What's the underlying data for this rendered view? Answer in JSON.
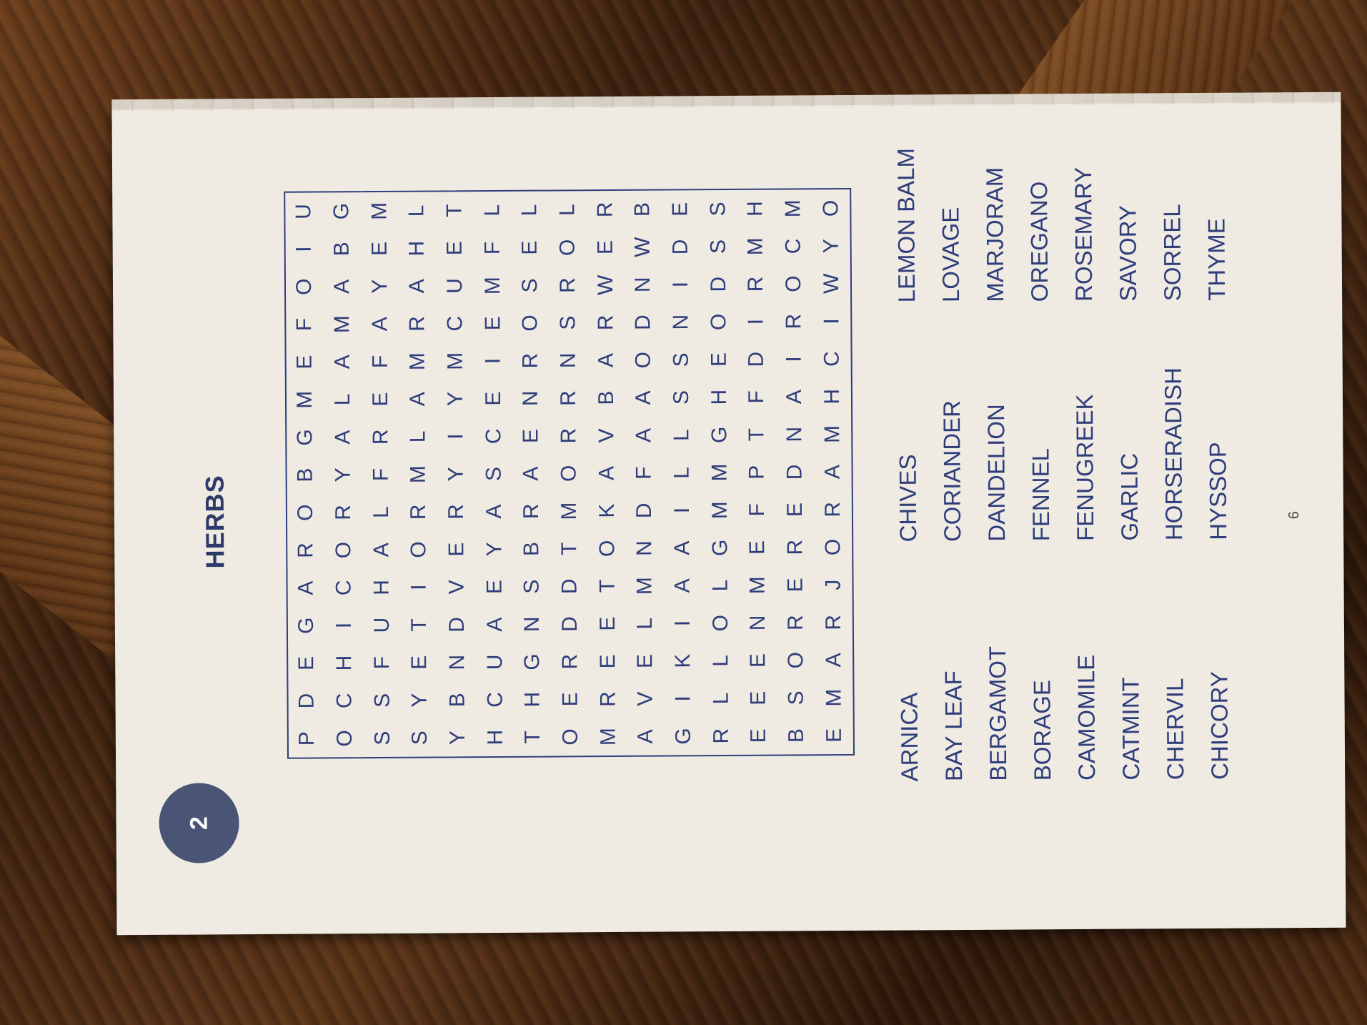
{
  "puzzle": {
    "number": "2",
    "title": "HERBS",
    "page_number": "6",
    "grid": [
      [
        "P",
        "D",
        "E",
        "G",
        "A",
        "R",
        "O",
        "B",
        "G",
        "M",
        "E",
        "F",
        "O",
        "I",
        "U"
      ],
      [
        "O",
        "C",
        "H",
        "I",
        "C",
        "O",
        "R",
        "Y",
        "A",
        "L",
        "A",
        "M",
        "A",
        "B",
        "G"
      ],
      [
        "S",
        "S",
        "F",
        "U",
        "H",
        "A",
        "L",
        "F",
        "R",
        "E",
        "F",
        "A",
        "Y",
        "E",
        "M"
      ],
      [
        "S",
        "Y",
        "E",
        "T",
        "I",
        "O",
        "R",
        "M",
        "L",
        "A",
        "M",
        "R",
        "A",
        "H",
        "L"
      ],
      [
        "Y",
        "B",
        "N",
        "D",
        "V",
        "E",
        "R",
        "Y",
        "I",
        "Y",
        "M",
        "C",
        "U",
        "E",
        "T"
      ],
      [
        "H",
        "C",
        "U",
        "A",
        "E",
        "Y",
        "A",
        "S",
        "C",
        "E",
        "I",
        "E",
        "M",
        "F",
        "L"
      ],
      [
        "T",
        "H",
        "G",
        "N",
        "S",
        "B",
        "R",
        "A",
        "E",
        "N",
        "R",
        "O",
        "S",
        "E",
        "L"
      ],
      [
        "O",
        "E",
        "R",
        "D",
        "D",
        "T",
        "M",
        "O",
        "R",
        "R",
        "N",
        "S",
        "R",
        "O",
        "L"
      ],
      [
        "M",
        "R",
        "E",
        "E",
        "T",
        "O",
        "K",
        "A",
        "V",
        "B",
        "A",
        "R",
        "W",
        "E",
        "R"
      ],
      [
        "A",
        "V",
        "E",
        "L",
        "M",
        "N",
        "D",
        "F",
        "A",
        "A",
        "O",
        "D",
        "N",
        "W",
        "B"
      ],
      [
        "G",
        "I",
        "K",
        "I",
        "A",
        "A",
        "I",
        "L",
        "L",
        "S",
        "S",
        "N",
        "I",
        "D",
        "E"
      ],
      [
        "R",
        "L",
        "L",
        "O",
        "L",
        "G",
        "M",
        "M",
        "G",
        "H",
        "E",
        "O",
        "D",
        "S",
        "S"
      ],
      [
        "E",
        "E",
        "E",
        "N",
        "M",
        "E",
        "F",
        "P",
        "T",
        "F",
        "D",
        "I",
        "R",
        "M",
        "H"
      ],
      [
        "B",
        "S",
        "O",
        "R",
        "E",
        "R",
        "E",
        "D",
        "N",
        "A",
        "I",
        "R",
        "O",
        "C",
        "M"
      ],
      [
        "E",
        "M",
        "A",
        "R",
        "J",
        "O",
        "R",
        "A",
        "M",
        "H",
        "C",
        "I",
        "W",
        "Y",
        "O"
      ]
    ],
    "word_columns": [
      [
        "ARNICA",
        "BAY LEAF",
        "BERGAMOT",
        "BORAGE",
        "CAMOMILE",
        "CATMINT",
        "CHERVIL",
        "CHICORY"
      ],
      [
        "CHIVES",
        "CORIANDER",
        "DANDELION",
        "FENNEL",
        "FENUGREEK",
        "GARLIC",
        "HORSERADISH",
        "HYSSOP"
      ],
      [
        "LEMON BALM",
        "LOVAGE",
        "MARJORAM",
        "OREGANO",
        "ROSEMARY",
        "SAVORY",
        "SORREL",
        "THYME"
      ]
    ]
  }
}
